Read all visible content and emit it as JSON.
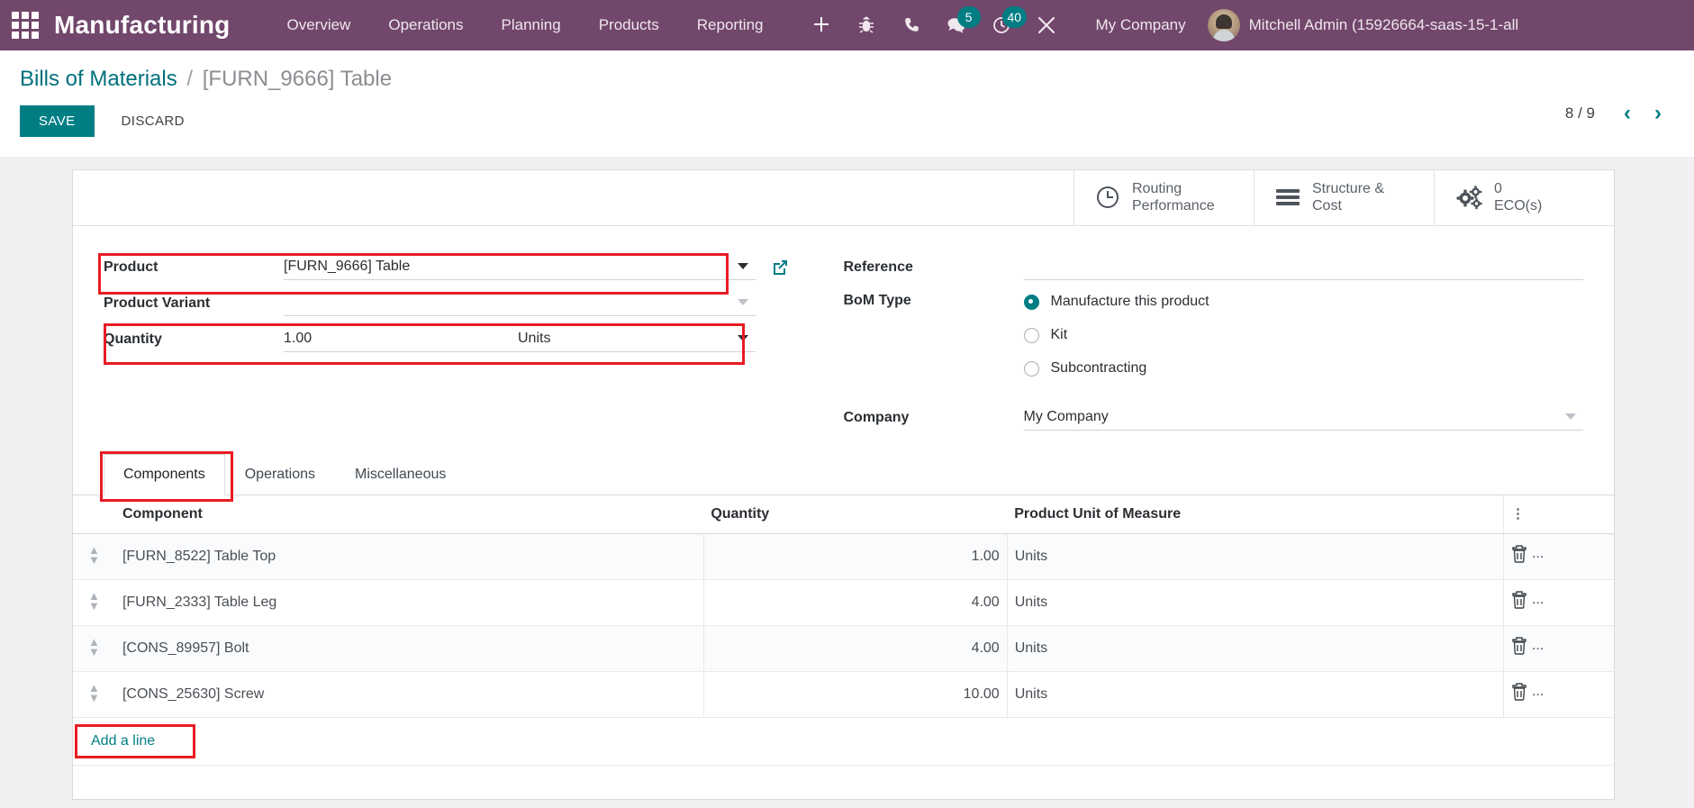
{
  "navbar": {
    "apps_icon": "apps-grid-icon",
    "brand": "Manufacturing",
    "menu": [
      "Overview",
      "Operations",
      "Planning",
      "Products",
      "Reporting"
    ],
    "icons": [
      {
        "name": "plus-icon",
        "badge": null
      },
      {
        "name": "bug-icon",
        "badge": null
      },
      {
        "name": "phone-icon",
        "badge": null
      },
      {
        "name": "chat-icon",
        "badge": "5"
      },
      {
        "name": "activity-clock-icon",
        "badge": "40"
      },
      {
        "name": "tools-icon",
        "badge": null
      }
    ],
    "company": "My Company",
    "user": "Mitchell Admin (15926664-saas-15-1-all",
    "bg_color": "#71476b"
  },
  "breadcrumb": {
    "root": "Bills of Materials",
    "separator": "/",
    "current": "[FURN_9666] Table"
  },
  "actions": {
    "save_label": "SAVE",
    "discard_label": "DISCARD",
    "save_color": "#017e84"
  },
  "pager": {
    "count": "8 / 9",
    "prev_icon": "chevron-left-icon",
    "next_icon": "chevron-right-icon"
  },
  "stat_buttons": [
    {
      "icon": "clock-icon",
      "line1": "Routing",
      "line2": "Performance"
    },
    {
      "icon": "bars-icon",
      "line1": "Structure &",
      "line2": "Cost"
    },
    {
      "icon": "gears-icon",
      "line1": "0",
      "line2": "ECO(s)"
    }
  ],
  "form": {
    "left": {
      "product_label": "Product",
      "product_value": "[FURN_9666] Table",
      "product_variant_label": "Product Variant",
      "product_variant_value": "",
      "quantity_label": "Quantity",
      "quantity_value": "1.00",
      "quantity_uom": "Units",
      "external_link_icon": "external-link-icon"
    },
    "right": {
      "reference_label": "Reference",
      "reference_value": "",
      "bom_type_label": "BoM Type",
      "bom_type_options": [
        {
          "label": "Manufacture this product",
          "selected": true
        },
        {
          "label": "Kit",
          "selected": false
        },
        {
          "label": "Subcontracting",
          "selected": false
        }
      ],
      "company_label": "Company",
      "company_value": "My Company"
    }
  },
  "highlight_color": "#e81c23",
  "tabs": [
    {
      "label": "Components",
      "active": true,
      "highlighted": true
    },
    {
      "label": "Operations",
      "active": false,
      "highlighted": false
    },
    {
      "label": "Miscellaneous",
      "active": false,
      "highlighted": false
    }
  ],
  "table": {
    "columns": [
      "Component",
      "Quantity",
      "Product Unit of Measure"
    ],
    "optional_columns_icon": "vertical-dots-icon",
    "rows": [
      {
        "handle": "drag-handle-icon",
        "component": "[FURN_8522] Table Top",
        "quantity": "1.00",
        "uom": "Units",
        "delete_icon": "trash-icon",
        "more": "..."
      },
      {
        "handle": "drag-handle-icon",
        "component": "[FURN_2333] Table Leg",
        "quantity": "4.00",
        "uom": "Units",
        "delete_icon": "trash-icon",
        "more": "..."
      },
      {
        "handle": "drag-handle-icon",
        "component": "[CONS_89957] Bolt",
        "quantity": "4.00",
        "uom": "Units",
        "delete_icon": "trash-icon",
        "more": "..."
      },
      {
        "handle": "drag-handle-icon",
        "component": "[CONS_25630] Screw",
        "quantity": "10.00",
        "uom": "Units",
        "delete_icon": "trash-icon",
        "more": "..."
      }
    ],
    "add_line_label": "Add a line"
  }
}
